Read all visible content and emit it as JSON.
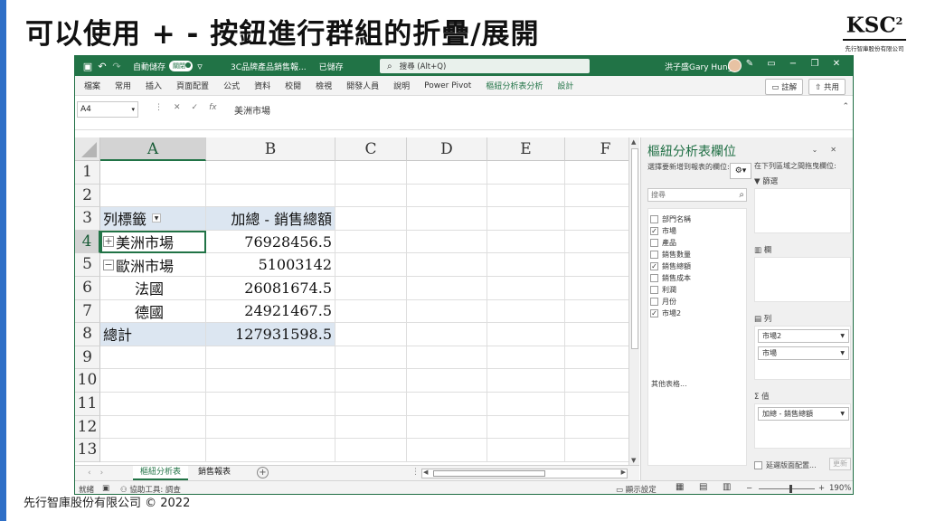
{
  "slide": {
    "title": "可以使用 + - 按鈕進行群組的折疊/展開",
    "logo_mark": "KSC",
    "logo_superscript": "2",
    "logo_text": "先行智庫股份有限公司",
    "footer": "先行智庫股份有限公司 © 2022",
    "accent_color": "#2e6fc7"
  },
  "excel": {
    "brand_color": "#217346",
    "titlebar": {
      "autosave_label": "自動儲存",
      "autosave_toggle": "關閉",
      "doc_name": "3C品牌產品銷售報...",
      "saved_status": "已儲存",
      "search_placeholder": "搜尋 (Alt+Q)",
      "user_name": "洪子盛Gary Hung",
      "icons": [
        "save-icon",
        "undo-icon",
        "redo-icon",
        "customize-icon",
        "pen-icon",
        "ribbon-display-icon",
        "minimize-icon",
        "restore-icon",
        "close-icon"
      ]
    },
    "ribbon": {
      "tabs": [
        "檔案",
        "常用",
        "插入",
        "頁面配置",
        "公式",
        "資料",
        "校閱",
        "檢視",
        "開發人員",
        "說明",
        "Power Pivot",
        "樞紐分析表分析",
        "設計"
      ],
      "comments_label": "註解",
      "share_label": "共用"
    },
    "formula_bar": {
      "name_box": "A4",
      "value": "美洲市場"
    },
    "columns": [
      "A",
      "B",
      "C",
      "D",
      "E",
      "F"
    ],
    "rows": [
      {
        "num": "1",
        "a": "",
        "b": ""
      },
      {
        "num": "2",
        "a": "",
        "b": ""
      },
      {
        "num": "3",
        "a": "列標籤",
        "b": "加總 - 銷售總額"
      },
      {
        "num": "4",
        "a": "美洲市場",
        "b": "76928456.5",
        "toggle": "+"
      },
      {
        "num": "5",
        "a": "歐洲市場",
        "b": "51003142",
        "toggle": "−"
      },
      {
        "num": "6",
        "a": "法國",
        "b": "26081674.5"
      },
      {
        "num": "7",
        "a": "德國",
        "b": "24921467.5"
      },
      {
        "num": "8",
        "a": "總計",
        "b": "127931598.5"
      },
      {
        "num": "9",
        "a": "",
        "b": ""
      },
      {
        "num": "10",
        "a": "",
        "b": ""
      },
      {
        "num": "11",
        "a": "",
        "b": ""
      },
      {
        "num": "12",
        "a": "",
        "b": ""
      },
      {
        "num": "13",
        "a": "",
        "b": ""
      }
    ],
    "sheets": [
      "樞紐分析表",
      "銷售報表"
    ],
    "active_sheet": "樞紐分析表",
    "statusbar": {
      "ready": "就緒",
      "accessibility": "協助工具: 調查",
      "display_settings": "顯示設定",
      "zoom_minus": "−",
      "zoom_plus": "+",
      "zoom": "190%"
    },
    "pivot_pane": {
      "title": "樞紐分析表欄位",
      "subtitle": "選擇要新增到報表的欄位:",
      "search_placeholder": "搜尋",
      "fields": [
        {
          "name": "部門名稱",
          "checked": false
        },
        {
          "name": "市場",
          "checked": true
        },
        {
          "name": "產品",
          "checked": false
        },
        {
          "name": "銷售數量",
          "checked": false
        },
        {
          "name": "銷售總額",
          "checked": true
        },
        {
          "name": "銷售成本",
          "checked": false
        },
        {
          "name": "利潤",
          "checked": false
        },
        {
          "name": "月份",
          "checked": false
        },
        {
          "name": "市場2",
          "checked": true
        }
      ],
      "more_tables": "其他表格...",
      "drag_hint": "在下列區域之間拖曳欄位:",
      "filters_label": "篩選",
      "columns_label": "欄",
      "rows_label": "列",
      "row_items": [
        "市場2",
        "市場"
      ],
      "values_label": "值",
      "value_items": [
        "加總 - 銷售總額"
      ],
      "defer_label": "延遲版面配置...",
      "update_label": "更新"
    }
  }
}
